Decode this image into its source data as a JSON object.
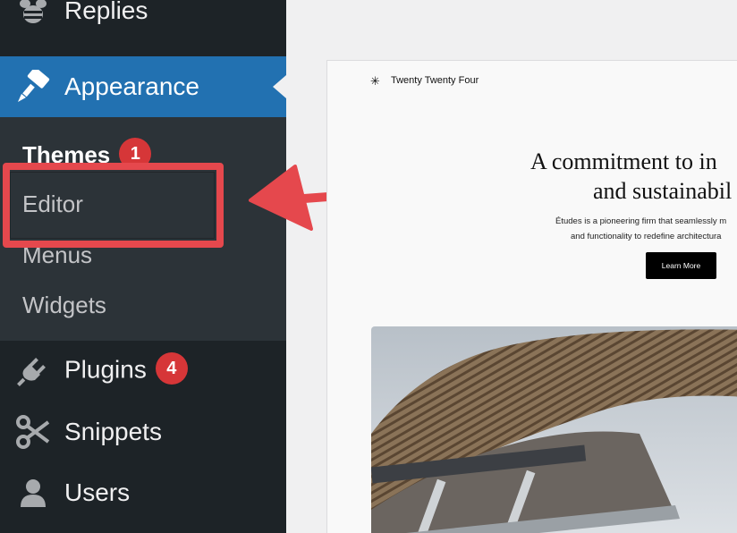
{
  "sidebar": {
    "items": [
      {
        "label": "Replies",
        "icon": "bee-icon"
      },
      {
        "label": "Appearance",
        "icon": "paintbrush-icon",
        "active": true
      },
      {
        "label": "Plugins",
        "icon": "plug-icon",
        "badge": "4"
      },
      {
        "label": "Snippets",
        "icon": "scissors-icon"
      },
      {
        "label": "Users",
        "icon": "user-icon"
      }
    ],
    "appearance_submenu": [
      {
        "label": "Themes",
        "badge": "1",
        "current": true
      },
      {
        "label": "Editor"
      },
      {
        "label": "Menus"
      },
      {
        "label": "Widgets"
      }
    ]
  },
  "preview": {
    "site_logo": "✳",
    "site_title": "Twenty Twenty Four",
    "hero_line1": "A commitment to in",
    "hero_line2": "and sustainabil",
    "description_line1": "Études is a pioneering firm that seamlessly m",
    "description_line2": "and functionality to redefine architectura",
    "button_label": "Learn More"
  },
  "colors": {
    "sidebar_bg": "#1d2327",
    "submenu_bg": "#2c3338",
    "active_bg": "#2271b1",
    "badge_bg": "#d63638",
    "annotation_red": "#e5484d"
  }
}
